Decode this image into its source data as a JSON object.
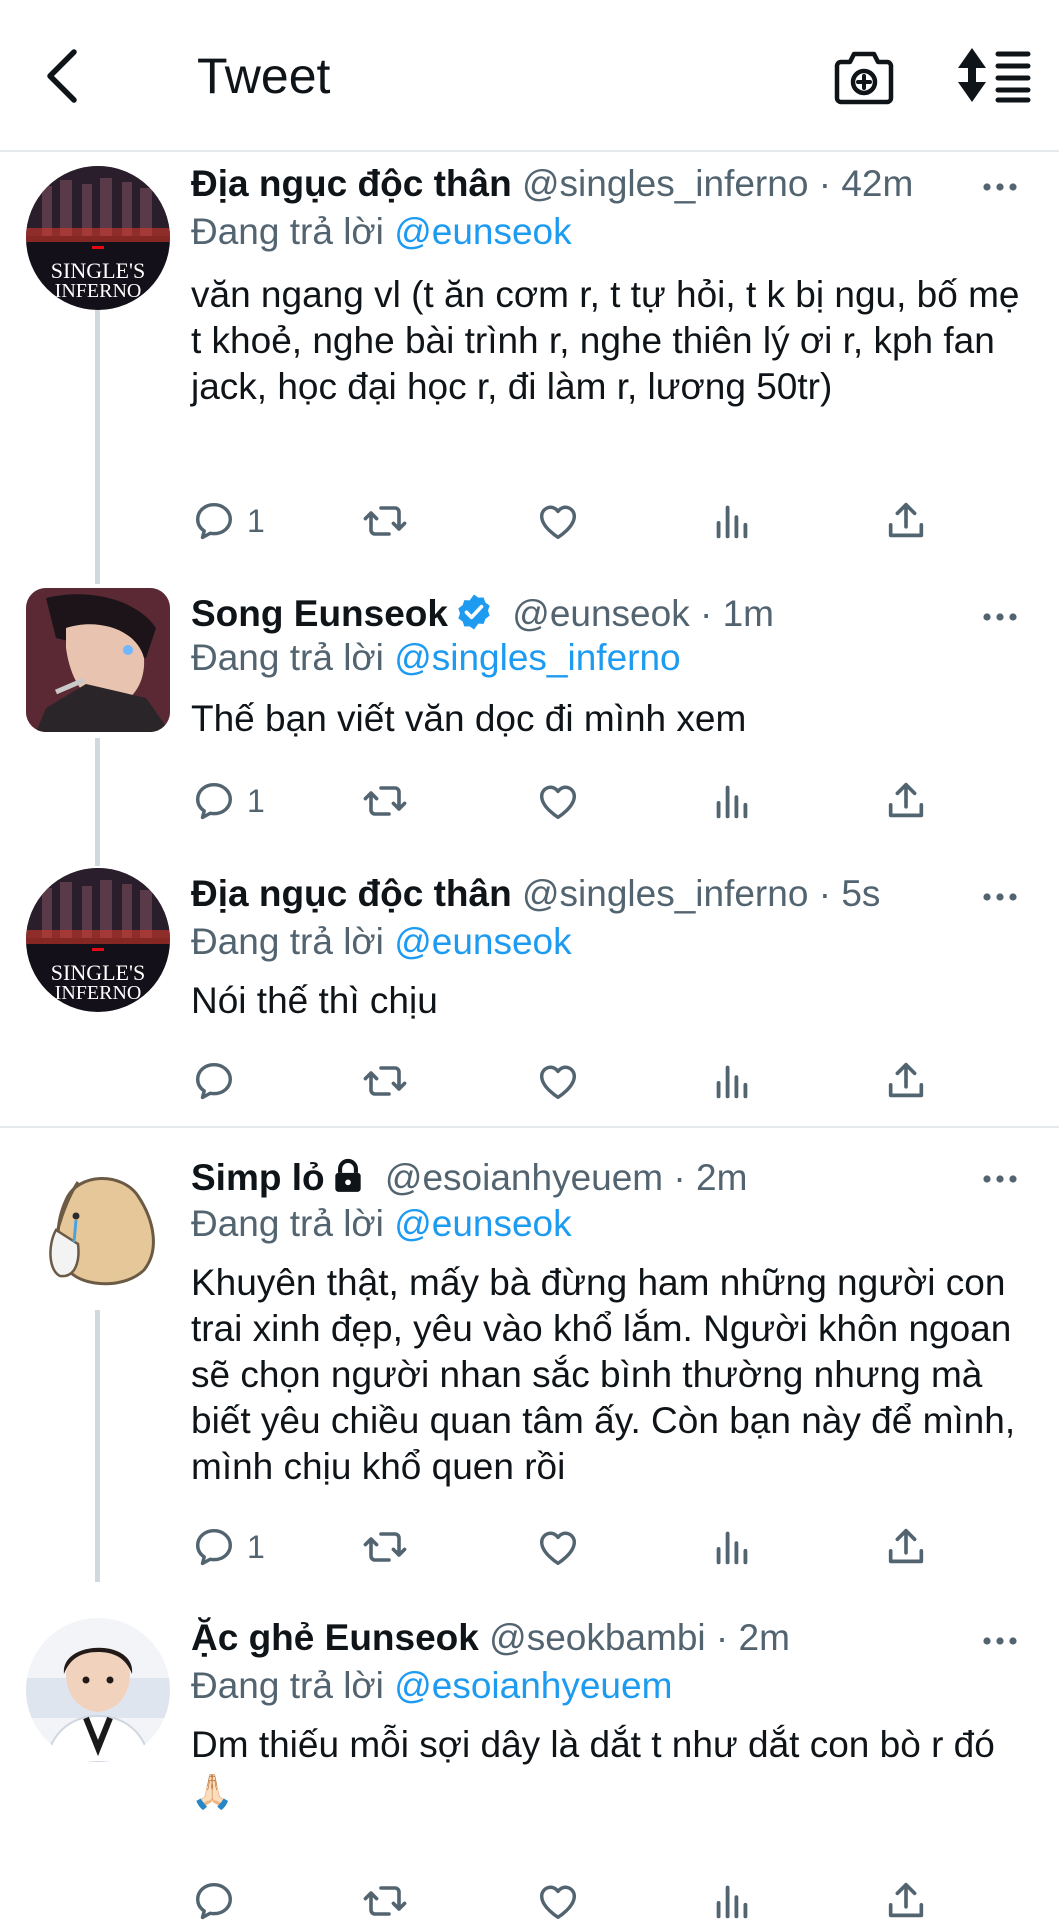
{
  "header": {
    "title": "Tweet"
  },
  "tweets": [
    {
      "name": "Địa ngục độc thân",
      "handle": "@singles_inferno",
      "dot": "·",
      "time": "42m",
      "replying_prefix": "Đang trả lời",
      "replying_to": "@eunseok",
      "text": "văn ngang vl (t ăn cơm r, t tự hỏi, t k bị ngu, bố mẹ t khoẻ, nghe bài trình r, nghe thiên lý ơi r, kph fan jack, học đại học r, đi làm r, lương 50tr)",
      "reply_count": "1",
      "avatar_text_1": "SINGLE'S",
      "avatar_text_2": "INFERNO"
    },
    {
      "name": "Song Eunseok",
      "handle": "@eunseok",
      "dot": "·",
      "time": "1m",
      "replying_prefix": "Đang trả lời",
      "replying_to": "@singles_inferno",
      "text": "Thế bạn viết văn dọc đi mình xem",
      "reply_count": "1"
    },
    {
      "name": "Địa ngục độc thân",
      "handle": "@singles_inferno",
      "dot": "·",
      "time": "5s",
      "replying_prefix": "Đang trả lời",
      "replying_to": "@eunseok",
      "text": "Nói thế thì chịu",
      "reply_count": "",
      "avatar_text_1": "SINGLE'S",
      "avatar_text_2": "INFERNO"
    },
    {
      "name": "Simp lỏ",
      "handle": "@esoianhyeuem",
      "dot": "·",
      "time": "2m",
      "replying_prefix": "Đang trả lời",
      "replying_to": "@eunseok",
      "text": "Khuyên thật, mấy bà đừng ham những người con trai xinh đẹp, yêu vào khổ lắm. Người khôn ngoan sẽ chọn người nhan sắc bình thường nhưng mà biết yêu chiều quan tâm ấy. Còn bạn này để mình, mình chịu khổ quen rồi",
      "reply_count": "1"
    },
    {
      "name": "Ặc ghẻ Eunseok",
      "handle": "@seokbambi",
      "dot": "·",
      "time": "2m",
      "replying_prefix": "Đang trả lời",
      "replying_to": "@esoianhyeuem",
      "text": "Dm thiếu mỗi sợi dây là dắt t như dắt con bò r đó",
      "emoji": "🙏🏻",
      "reply_count": ""
    }
  ],
  "icons": {
    "back": "chevron-left-icon",
    "camera": "camera-plus-icon",
    "sort": "sort-list-icon",
    "more": "more-dots-icon",
    "reply": "reply-bubble-icon",
    "retweet": "retweet-icon",
    "like": "heart-icon",
    "analytics": "analytics-icon",
    "share": "share-icon",
    "verified": "verified-badge-icon",
    "lock": "lock-icon"
  },
  "colors": {
    "link": "#1d9bf0",
    "secondary_text": "#536471",
    "divider": "#e6e9eb",
    "thread_line": "#cfd9de"
  }
}
